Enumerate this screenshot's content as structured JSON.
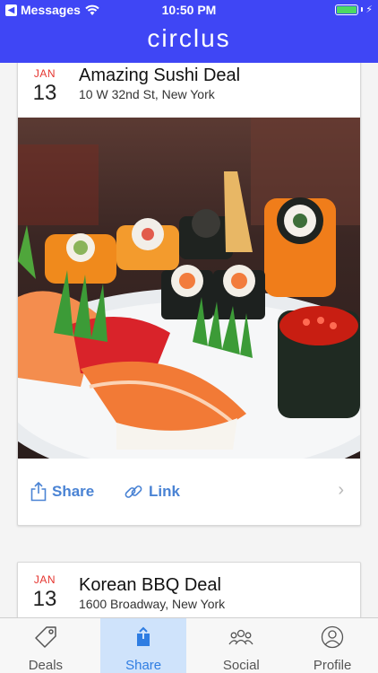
{
  "status_bar": {
    "carrier": "Messages",
    "time": "10:50 PM"
  },
  "header": {
    "brand": "circlus"
  },
  "deals": [
    {
      "month": "JAN",
      "day": "13",
      "title": "Amazing Sushi Deal",
      "address": "10 W 32nd St, New York",
      "actions": {
        "share_label": "Share",
        "link_label": "Link"
      }
    },
    {
      "month": "JAN",
      "day": "13",
      "title": "Korean BBQ Deal",
      "address": "1600 Broadway, New York"
    }
  ],
  "tabs": [
    {
      "label": "Deals",
      "icon": "tag-icon",
      "active": false
    },
    {
      "label": "Share",
      "icon": "share-icon",
      "active": true
    },
    {
      "label": "Social",
      "icon": "group-icon",
      "active": false
    },
    {
      "label": "Profile",
      "icon": "person-icon",
      "active": false
    }
  ],
  "colors": {
    "brand": "#3f46f5",
    "accent": "#4a83d4",
    "date_month": "#e5342e",
    "tab_active_bg": "#cfe3fb",
    "battery": "#4cd964"
  }
}
